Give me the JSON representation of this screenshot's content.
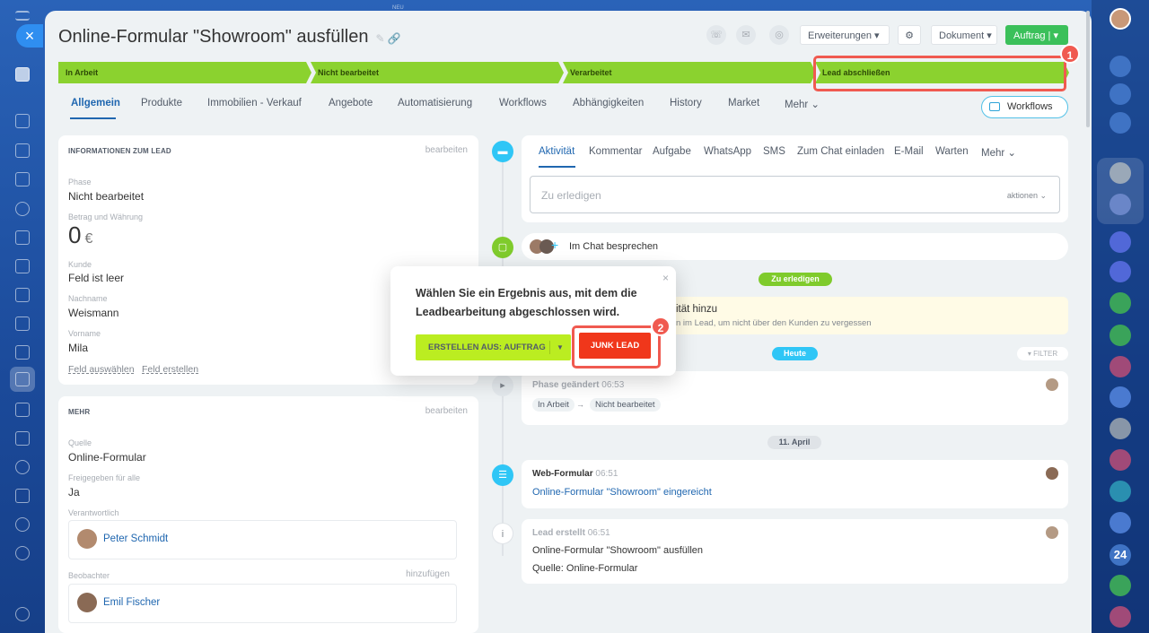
{
  "header": {
    "title": "Online-Formular \"Showroom\" ausfüllen",
    "buttons": {
      "extensions": "Erweiterungen",
      "document": "Dokument",
      "order": "Auftrag"
    },
    "top_tag": "NEU"
  },
  "stages": [
    "In Arbeit",
    "Nicht bearbeitet",
    "Verarbeitet",
    "Lead abschließen"
  ],
  "badges": [
    "1",
    "2"
  ],
  "tabs": [
    "Allgemein",
    "Produkte",
    "Immobilien - Verkauf",
    "Angebote",
    "Automatisierung",
    "Workflows",
    "Abhängigkeiten",
    "History",
    "Market",
    "Mehr"
  ],
  "workflows_button": "Workflows",
  "lead_info": {
    "title": "INFORMATIONEN ZUM LEAD",
    "edit": "bearbeiten",
    "phase_label": "Phase",
    "phase_value": "Nicht bearbeitet",
    "amount_label": "Betrag und Währung",
    "amount_value": "0",
    "currency": "€",
    "client_label": "Kunde",
    "client_value": "Feld ist leer",
    "lastname_label": "Nachname",
    "lastname_value": "Weismann",
    "firstname_label": "Vorname",
    "firstname_value": "Mila",
    "select_field": "Feld auswählen",
    "create_field": "Feld erstellen"
  },
  "more": {
    "title": "MEHR",
    "edit": "bearbeiten",
    "source_label": "Quelle",
    "source_value": "Online-Formular",
    "shared_label": "Freigegeben für alle",
    "shared_value": "Ja",
    "responsible_label": "Verantwortlich",
    "responsible_name": "Peter Schmidt",
    "observer_label": "Beobachter",
    "observer_add": "hinzufügen",
    "observer_name": "Emil Fischer"
  },
  "activity": {
    "tabs": [
      "Aktivität",
      "Kommentar",
      "Aufgabe",
      "WhatsApp",
      "SMS",
      "Zum Chat einladen",
      "E-Mail",
      "Warten",
      "Mehr"
    ],
    "todo_placeholder": "Zu erledigen",
    "todo_actions": "aktionen",
    "chat_discuss": "Im Chat besprechen",
    "pill_todo": "Zu erledigen",
    "add_title": "ität hinzu",
    "add_sub": "n im Lead, um nicht über den Kunden zu vergessen",
    "pill_today": "Heute",
    "filter": "FILTER",
    "phase_changed": "Phase geändert",
    "phase_time": "06:53",
    "phase_from": "In Arbeit",
    "phase_to": "Nicht bearbeitet",
    "pill_date": "11. April",
    "webform_title": "Web-Formular",
    "webform_time": "06:51",
    "webform_link": "Online-Formular \"Showroom\" eingereicht",
    "created_title": "Lead erstellt",
    "created_time": "06:51",
    "created_line1": "Online-Formular \"Showroom\" ausfüllen",
    "created_line2": "Quelle: Online-Formular"
  },
  "popup": {
    "text": "Wählen Sie ein Ergebnis aus, mit dem die Leadbearbeitung abgeschlossen wird.",
    "create_from": "ERSTELLEN AUS: AUFTRAG",
    "junk": "JUNK LEAD"
  },
  "right_sidebar": {
    "counter": "24"
  },
  "colors": {
    "stage_green": "#8bd22f",
    "accent_blue": "#2067b0",
    "junk_red": "#f0371b",
    "highlight": "#f05a50"
  }
}
